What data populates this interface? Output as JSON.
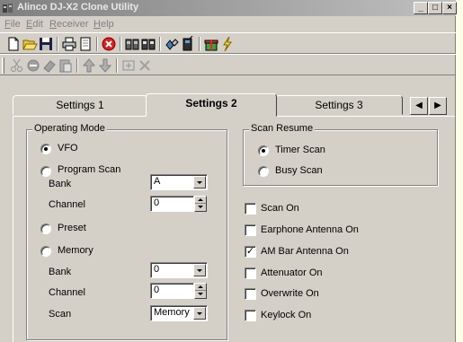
{
  "window": {
    "title": "Alinco DJ-X2 Clone Utility"
  },
  "menu": {
    "file": {
      "hot": "F",
      "rest": "ile"
    },
    "edit": {
      "hot": "E",
      "rest": "dit"
    },
    "receiver": {
      "hot": "R",
      "rest": "eceiver"
    },
    "help": {
      "hot": "H",
      "rest": "elp"
    }
  },
  "toolbar1": [
    "new-icon",
    "open-icon",
    "save-icon",
    "print-icon",
    "copy-page-icon",
    "stop-icon",
    "read-radio-icon",
    "write-radio-icon",
    "link-icon",
    "radio-icon",
    "gift-icon",
    "lightning-icon"
  ],
  "toolbar2": [
    "cut-icon",
    "erase-icon",
    "eraser-icon",
    "paste-icon",
    "move-up-icon",
    "move-down-icon",
    "insert-icon",
    "delete-icon"
  ],
  "tabs": {
    "settings1": "Settings 1",
    "settings2": "Settings 2",
    "settings3": "Settings 3"
  },
  "operating_mode": {
    "title": "Operating Mode",
    "vfo": "VFO",
    "program_scan": "Program Scan",
    "bank_label": "Bank",
    "bank_value": "A",
    "channel_label": "Channel",
    "channel_value": "0",
    "preset": "Preset",
    "memory": "Memory",
    "mem_bank_label": "Bank",
    "mem_bank_value": "0",
    "mem_channel_label": "Channel",
    "mem_channel_value": "0",
    "scan_label": "Scan",
    "scan_value": "Memory"
  },
  "scan_resume": {
    "title": "Scan Resume",
    "timer_scan": "Timer Scan",
    "busy_scan": "Busy Scan"
  },
  "options": {
    "scan_on": "Scan On",
    "earphone_antenna": "Earphone Antenna On",
    "am_bar_antenna": "AM Bar Antenna On",
    "attenuator": "Attenuator On",
    "overwrite": "Overwrite On",
    "keylock": "Keylock On"
  }
}
